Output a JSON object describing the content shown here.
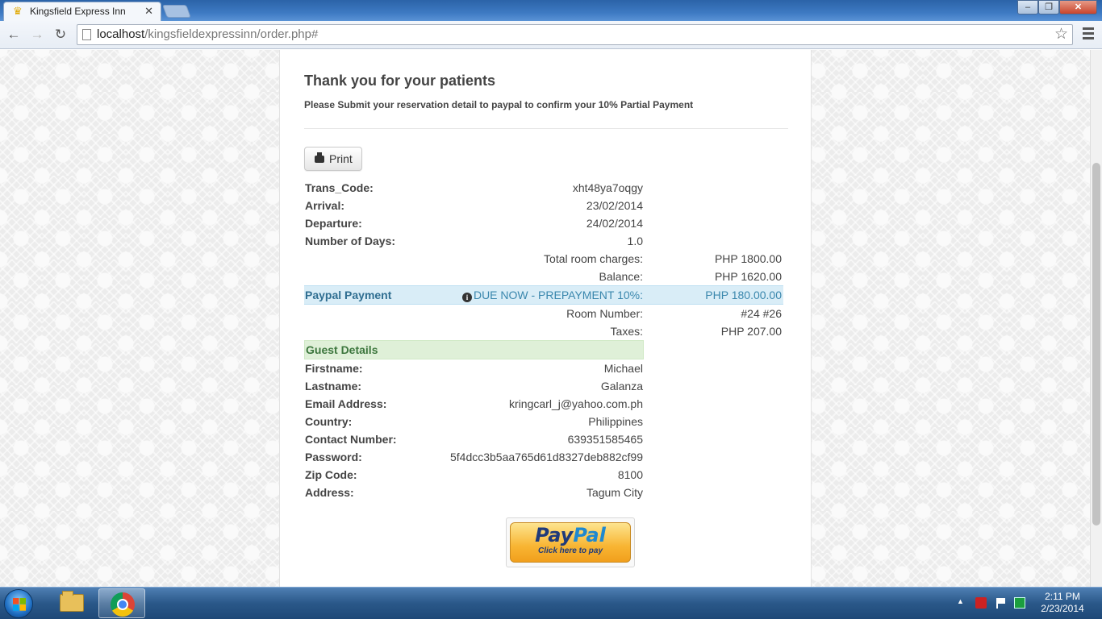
{
  "browser": {
    "tab_title": "Kingsfield Express Inn",
    "url_host": "localhost",
    "url_path": "/kingsfieldexpressinn/order.php#"
  },
  "page": {
    "heading": "Thank you for your patients",
    "subheading": "Please Submit your reservation detail to paypal to confirm your 10% Partial Payment",
    "print_label": "Print",
    "reservation": [
      {
        "label": "Trans_Code:",
        "value": "xht48ya7oqgy"
      },
      {
        "label": "Arrival:",
        "value": "23/02/2014"
      },
      {
        "label": "Departure:",
        "value": "24/02/2014"
      },
      {
        "label": "Number of Days:",
        "value": "1.0"
      }
    ],
    "charges": [
      {
        "label": "Total room charges:",
        "value": "PHP 1800.00"
      },
      {
        "label": "Balance:",
        "value": "PHP 1620.00"
      }
    ],
    "paypal_row": {
      "label": "Paypal Payment",
      "due_label": "DUE NOW - PREPAYMENT 10%:",
      "due_value": "PHP 180.00.00"
    },
    "extra_charges": [
      {
        "label": "Room Number:",
        "value": "#24 #26"
      },
      {
        "label": "Taxes:",
        "value": "PHP 207.00"
      }
    ],
    "guest_heading": "Guest Details",
    "guest": [
      {
        "label": "Firstname:",
        "value": "Michael"
      },
      {
        "label": "Lastname:",
        "value": "Galanza"
      },
      {
        "label": "Email Address:",
        "value": "kringcarl_j@yahoo.com.ph"
      },
      {
        "label": "Country:",
        "value": "Philippines"
      },
      {
        "label": "Contact Number:",
        "value": "639351585465"
      },
      {
        "label": "Password:",
        "value": "5f4dcc3b5aa765d61d8327deb882cf99"
      },
      {
        "label": "Zip Code:",
        "value": "8100"
      },
      {
        "label": "Address:",
        "value": "Tagum City"
      }
    ],
    "paypal_button": {
      "word_1": "Pay",
      "word_2": "Pal",
      "caption": "Click here to pay"
    }
  },
  "taskbar": {
    "time": "2:11 PM",
    "date": "2/23/2014"
  },
  "colors": {
    "info_bg": "#d9edf7",
    "info_text": "#3a87ad",
    "success_bg": "#dff0d8",
    "success_text": "#3c763d"
  }
}
